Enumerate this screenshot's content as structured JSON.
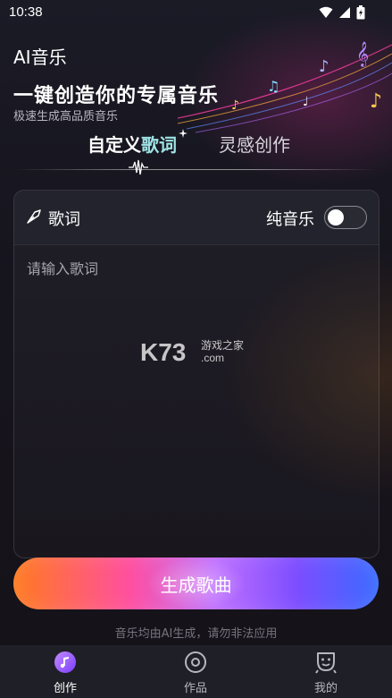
{
  "status_bar": {
    "time": "10:38"
  },
  "header": {
    "app_title": "AI音乐",
    "headline": "一键创造你的专属音乐",
    "subtitle": "极速生成高品质音乐"
  },
  "tabs": [
    {
      "label_part1": "自定义",
      "label_part2": "歌词",
      "active": true
    },
    {
      "label": "灵感创作",
      "active": false
    }
  ],
  "lyrics_card": {
    "header_label": "歌词",
    "pure_music_label": "纯音乐",
    "pure_music_on": false,
    "input_placeholder": "请输入歌词",
    "input_value": ""
  },
  "watermark": {
    "main": "K73",
    "cn": "游戏之家",
    "domain": ".com"
  },
  "generate_button": {
    "label": "生成歌曲"
  },
  "notice": "音乐均由AI生成，请勿非法应用",
  "bottom_nav": [
    {
      "label": "创作",
      "icon": "music-disc-icon",
      "active": true
    },
    {
      "label": "作品",
      "icon": "disc-icon",
      "active": false
    },
    {
      "label": "我的",
      "icon": "robot-face-icon",
      "active": false
    }
  ],
  "colors": {
    "background": "#14141c",
    "accent_cyan": "#9fe4e6",
    "button_gradient": [
      "#ff7a1f",
      "#ff4fa0",
      "#c070ff",
      "#7c4dff",
      "#3a6bff"
    ],
    "nav_active": "#ffffff"
  }
}
